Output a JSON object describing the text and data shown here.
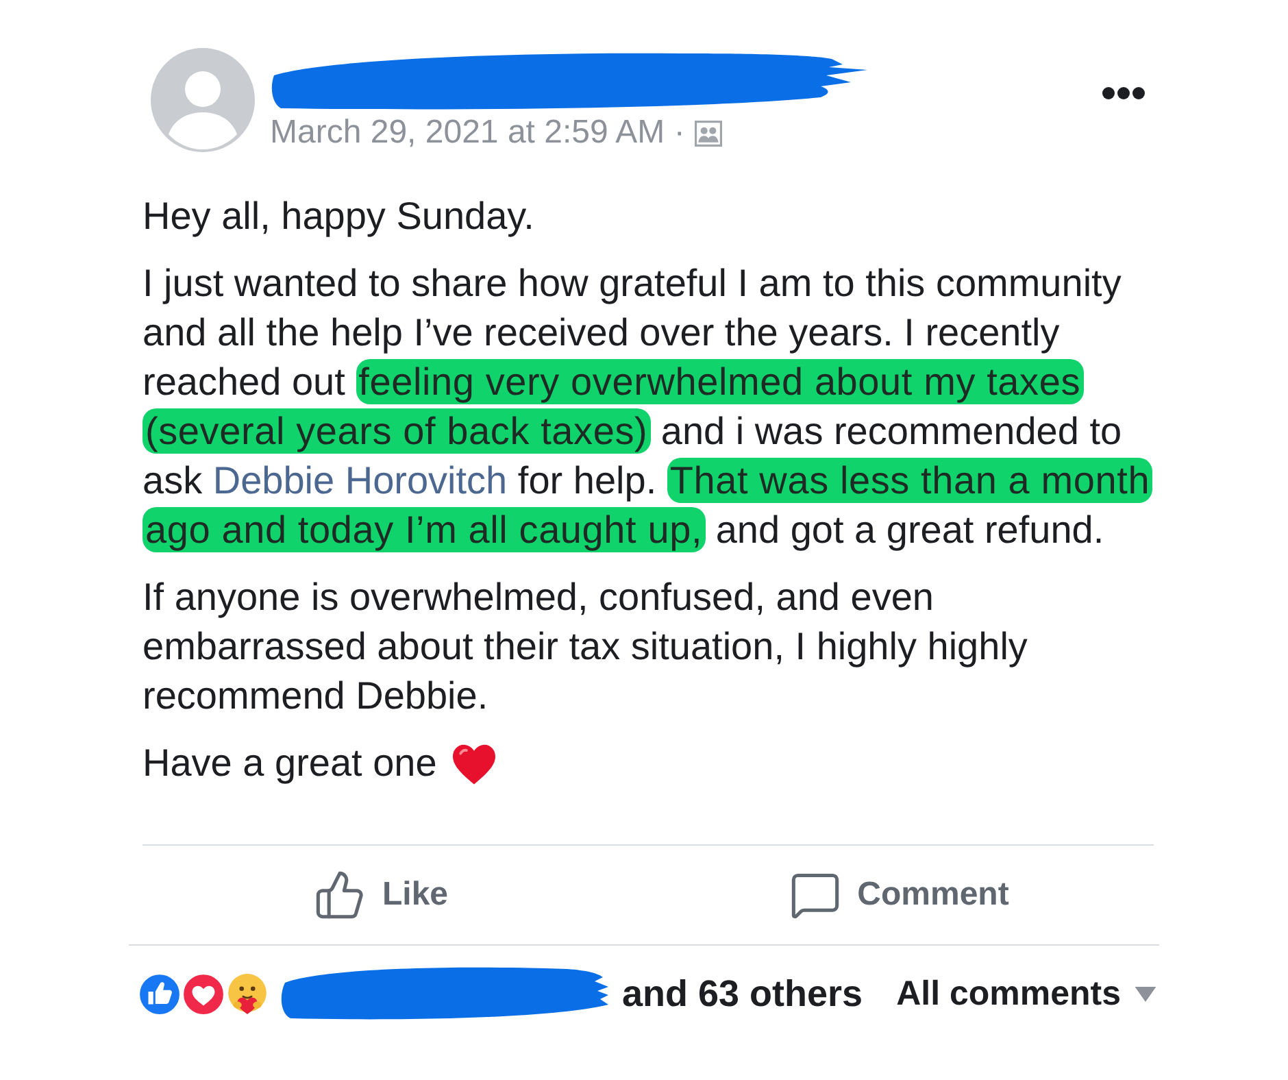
{
  "post": {
    "author": {
      "name_redacted": true
    },
    "timestamp": "March 29, 2021 at 2:59 AM ·",
    "paragraphs": [
      {
        "kind": "text",
        "segments": [
          {
            "kind": "plain",
            "text": "Hey all, happy Sunday."
          }
        ]
      },
      {
        "kind": "text",
        "segments": [
          {
            "kind": "plain",
            "text": "I just wanted to share how grateful I am to this community and all the help I’ve received over the years. I recently reached out "
          },
          {
            "kind": "highlight",
            "text": "feeling very overwhelmed about my taxes (several years of back taxes)"
          },
          {
            "kind": "plain",
            "text": " and i was recommended to ask "
          },
          {
            "kind": "link",
            "text": "Debbie Horovitch"
          },
          {
            "kind": "plain",
            "text": " for help. "
          },
          {
            "kind": "highlight",
            "text": "That was less than a month ago and today I’m all caught up,"
          },
          {
            "kind": "plain",
            "text": " and got a great refund."
          }
        ]
      },
      {
        "kind": "text",
        "segments": [
          {
            "kind": "plain",
            "text": "If anyone is overwhelmed, confused, and even embarrassed about their tax situation, I highly highly recommend Debbie."
          }
        ]
      },
      {
        "kind": "sign-off",
        "segments": [
          {
            "kind": "plain",
            "text": "Have a great one"
          }
        ]
      }
    ],
    "actions": [
      {
        "kind": "like",
        "label": "Like"
      },
      {
        "kind": "comment",
        "label": "Comment"
      }
    ],
    "reactions": {
      "icons": [
        {
          "kind": "like"
        },
        {
          "kind": "love"
        },
        {
          "kind": "care"
        }
      ],
      "names_redacted": true,
      "summary": "and 63 others"
    },
    "comments_filter": {
      "label": "All comments"
    }
  }
}
